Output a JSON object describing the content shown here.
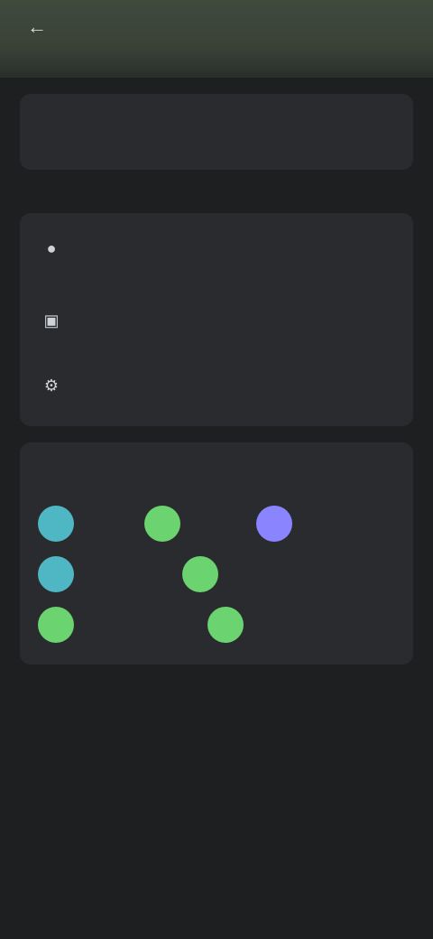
{
  "header": {
    "back_glyph": "←",
    "title": "",
    "action_label": ""
  },
  "account": {
    "name": "",
    "link": ""
  },
  "section_label": "",
  "list": [
    {
      "icon": "person-icon",
      "glyph": "●",
      "label": "",
      "sub": ""
    },
    {
      "icon": "photo-icon",
      "glyph": "▣",
      "label": "",
      "sub": ""
    },
    {
      "icon": "settings-icon",
      "glyph": "⚙",
      "label": "",
      "sub": ""
    }
  ],
  "tags": {
    "header": "",
    "more": "",
    "chips": [
      {
        "color": "#4fb7c4",
        "label": ""
      },
      {
        "color": "#6bd36f",
        "label": ""
      },
      {
        "color": "#8a84ff",
        "label": ""
      },
      {
        "color": "#4fb7c4",
        "label": ""
      },
      {
        "color": "#6bd36f",
        "label": ""
      },
      {
        "color": "#6bd36f",
        "label": ""
      },
      {
        "color": "#6bd36f",
        "label": ""
      }
    ]
  },
  "colors": {
    "accent": "#4e7fb8",
    "background": "#1e1f21",
    "card": "#2a2b2e"
  }
}
